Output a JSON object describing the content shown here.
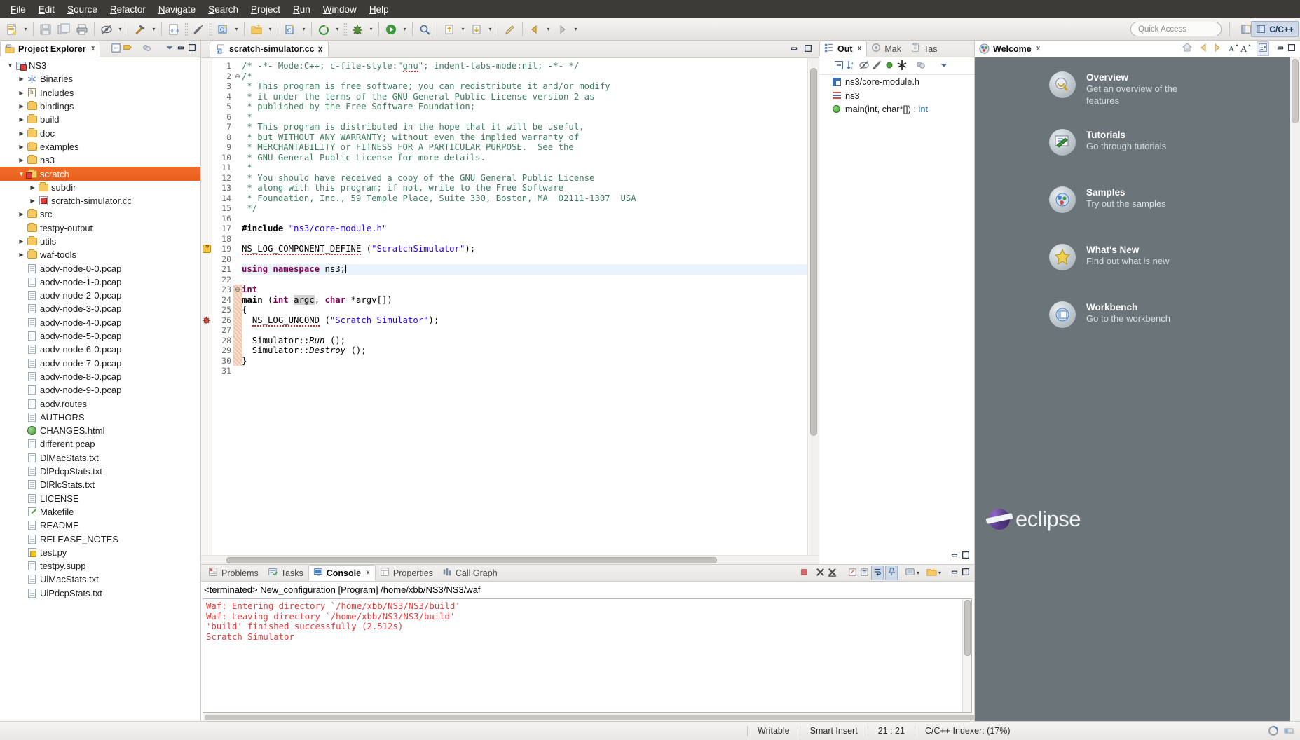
{
  "menu": {
    "items": [
      "File",
      "Edit",
      "Source",
      "Refactor",
      "Navigate",
      "Search",
      "Project",
      "Run",
      "Window",
      "Help"
    ]
  },
  "toolbar": {
    "quick_access_placeholder": "Quick Access",
    "perspective_label": "C/C++",
    "buttons": [
      "new-wizard",
      "save",
      "save-all",
      "print",
      "toggle-mark-occurrences",
      "build-hammer",
      "build-config",
      "skip-breakpoints",
      "new-c-class",
      "new-c-project",
      "new-c-source-file",
      "run-external-tools",
      "debug",
      "run"
    ]
  },
  "project_explorer": {
    "title": "Project Explorer",
    "toolbar": [
      "collapse-all",
      "link-with-editor",
      "focus-on-active-task",
      "view-menu",
      "minimize",
      "maximize"
    ],
    "tree": [
      {
        "label": "NS3",
        "depth": 0,
        "arrow": "down",
        "icon": "project",
        "selected": false
      },
      {
        "label": "Binaries",
        "depth": 1,
        "arrow": "right",
        "icon": "binaries",
        "selected": false
      },
      {
        "label": "Includes",
        "depth": 1,
        "arrow": "right",
        "icon": "includes",
        "selected": false
      },
      {
        "label": "bindings",
        "depth": 1,
        "arrow": "right",
        "icon": "folder",
        "selected": false
      },
      {
        "label": "build",
        "depth": 1,
        "arrow": "right",
        "icon": "folder",
        "selected": false
      },
      {
        "label": "doc",
        "depth": 1,
        "arrow": "right",
        "icon": "folder",
        "selected": false
      },
      {
        "label": "examples",
        "depth": 1,
        "arrow": "right",
        "icon": "folder",
        "selected": false
      },
      {
        "label": "ns3",
        "depth": 1,
        "arrow": "right",
        "icon": "folder",
        "selected": false
      },
      {
        "label": "scratch",
        "depth": 1,
        "arrow": "down",
        "icon": "source-folder",
        "selected": true
      },
      {
        "label": "subdir",
        "depth": 2,
        "arrow": "right",
        "icon": "folder",
        "selected": false
      },
      {
        "label": "scratch-simulator.cc",
        "depth": 2,
        "arrow": "right",
        "icon": "cc-file",
        "selected": false
      },
      {
        "label": "src",
        "depth": 1,
        "arrow": "right",
        "icon": "folder",
        "selected": false
      },
      {
        "label": "testpy-output",
        "depth": 1,
        "arrow": "none",
        "icon": "folder",
        "selected": false
      },
      {
        "label": "utils",
        "depth": 1,
        "arrow": "right",
        "icon": "folder",
        "selected": false
      },
      {
        "label": "waf-tools",
        "depth": 1,
        "arrow": "right",
        "icon": "folder",
        "selected": false
      },
      {
        "label": "aodv-node-0-0.pcap",
        "depth": 1,
        "arrow": "none",
        "icon": "file",
        "selected": false
      },
      {
        "label": "aodv-node-1-0.pcap",
        "depth": 1,
        "arrow": "none",
        "icon": "file",
        "selected": false
      },
      {
        "label": "aodv-node-2-0.pcap",
        "depth": 1,
        "arrow": "none",
        "icon": "file",
        "selected": false
      },
      {
        "label": "aodv-node-3-0.pcap",
        "depth": 1,
        "arrow": "none",
        "icon": "file",
        "selected": false
      },
      {
        "label": "aodv-node-4-0.pcap",
        "depth": 1,
        "arrow": "none",
        "icon": "file",
        "selected": false
      },
      {
        "label": "aodv-node-5-0.pcap",
        "depth": 1,
        "arrow": "none",
        "icon": "file",
        "selected": false
      },
      {
        "label": "aodv-node-6-0.pcap",
        "depth": 1,
        "arrow": "none",
        "icon": "file",
        "selected": false
      },
      {
        "label": "aodv-node-7-0.pcap",
        "depth": 1,
        "arrow": "none",
        "icon": "file",
        "selected": false
      },
      {
        "label": "aodv-node-8-0.pcap",
        "depth": 1,
        "arrow": "none",
        "icon": "file",
        "selected": false
      },
      {
        "label": "aodv-node-9-0.pcap",
        "depth": 1,
        "arrow": "none",
        "icon": "file",
        "selected": false
      },
      {
        "label": "aodv.routes",
        "depth": 1,
        "arrow": "none",
        "icon": "file",
        "selected": false
      },
      {
        "label": "AUTHORS",
        "depth": 1,
        "arrow": "none",
        "icon": "file",
        "selected": false
      },
      {
        "label": "CHANGES.html",
        "depth": 1,
        "arrow": "none",
        "icon": "html",
        "selected": false
      },
      {
        "label": "different.pcap",
        "depth": 1,
        "arrow": "none",
        "icon": "file",
        "selected": false
      },
      {
        "label": "DlMacStats.txt",
        "depth": 1,
        "arrow": "none",
        "icon": "file",
        "selected": false
      },
      {
        "label": "DlPdcpStats.txt",
        "depth": 1,
        "arrow": "none",
        "icon": "file",
        "selected": false
      },
      {
        "label": "DlRlcStats.txt",
        "depth": 1,
        "arrow": "none",
        "icon": "file",
        "selected": false
      },
      {
        "label": "LICENSE",
        "depth": 1,
        "arrow": "none",
        "icon": "file",
        "selected": false
      },
      {
        "label": "Makefile",
        "depth": 1,
        "arrow": "none",
        "icon": "makefile",
        "selected": false
      },
      {
        "label": "README",
        "depth": 1,
        "arrow": "none",
        "icon": "file",
        "selected": false
      },
      {
        "label": "RELEASE_NOTES",
        "depth": 1,
        "arrow": "none",
        "icon": "file",
        "selected": false
      },
      {
        "label": "test.py",
        "depth": 1,
        "arrow": "none",
        "icon": "python",
        "selected": false
      },
      {
        "label": "testpy.supp",
        "depth": 1,
        "arrow": "none",
        "icon": "file",
        "selected": false
      },
      {
        "label": "UlMacStats.txt",
        "depth": 1,
        "arrow": "none",
        "icon": "file",
        "selected": false
      },
      {
        "label": "UlPdcpStats.txt",
        "depth": 1,
        "arrow": "none",
        "icon": "file",
        "selected": false
      }
    ]
  },
  "editor": {
    "tab_label": "scratch-simulator.cc",
    "tab_close": "⌧",
    "lines": [
      {
        "n": 1,
        "html": "<span class=\"cmt\">/* -*- Mode:C++; c-file-style:\"<span class=\"spellerr\">gnu</span>\"; indent-tabs-mode:nil; -*- */</span>"
      },
      {
        "n": 2,
        "html": "<span class=\"cmt\">/*</span>",
        "fold": true
      },
      {
        "n": 3,
        "html": "<span class=\"cmt\"> * This program is free software; you can redistribute it and/or modify</span>"
      },
      {
        "n": 4,
        "html": "<span class=\"cmt\"> * it under the terms of the GNU General Public License version 2 as</span>"
      },
      {
        "n": 5,
        "html": "<span class=\"cmt\"> * published by the Free Software Foundation;</span>"
      },
      {
        "n": 6,
        "html": "<span class=\"cmt\"> *</span>"
      },
      {
        "n": 7,
        "html": "<span class=\"cmt\"> * This program is distributed in the hope that it will be useful,</span>"
      },
      {
        "n": 8,
        "html": "<span class=\"cmt\"> * but WITHOUT ANY WARRANTY; without even the implied warranty of</span>"
      },
      {
        "n": 9,
        "html": "<span class=\"cmt\"> * MERCHANTABILITY or FITNESS FOR A PARTICULAR PURPOSE.  See the</span>"
      },
      {
        "n": 10,
        "html": "<span class=\"cmt\"> * GNU General Public License for more details.</span>"
      },
      {
        "n": 11,
        "html": "<span class=\"cmt\"> *</span>"
      },
      {
        "n": 12,
        "html": "<span class=\"cmt\"> * You should have received a copy of the GNU General Public License</span>"
      },
      {
        "n": 13,
        "html": "<span class=\"cmt\"> * along with this program; if not, write to the Free Software</span>"
      },
      {
        "n": 14,
        "html": "<span class=\"cmt\"> * Foundation, Inc., 59 Temple Place, Suite 330, Boston, MA  02111-1307  USA</span>"
      },
      {
        "n": 15,
        "html": "<span class=\"cmt\"> */</span>"
      },
      {
        "n": 16,
        "html": ""
      },
      {
        "n": 17,
        "html": "<span class=\"pre\">#include</span> <span class=\"str\">\"ns3/core-module.h\"</span>"
      },
      {
        "n": 18,
        "html": ""
      },
      {
        "n": 19,
        "html": "<span class=\"spellerr\">NS_LOG_COMPONENT_DEFINE</span> (<span class=\"str\">\"ScratchSimulator\"</span>);",
        "marker": "warning"
      },
      {
        "n": 20,
        "html": ""
      },
      {
        "n": 21,
        "html": "<span class=\"kw\">using namespace</span> ns3;<span class=\"caret\"></span>",
        "highlight": true
      },
      {
        "n": 22,
        "html": ""
      },
      {
        "n": 23,
        "html": "<span class=\"kw\">int</span>",
        "fold": true,
        "changed": true
      },
      {
        "n": 24,
        "html": "<span class=\"pre\">main</span> (<span class=\"kw\">int</span> <span class=\"occ\">argc</span>, <span class=\"kw\">char</span> *argv[])",
        "changed": true
      },
      {
        "n": 25,
        "html": "{",
        "changed": true
      },
      {
        "n": 26,
        "html": "  <span class=\"spellerr\">NS_LOG_UNCOND</span> (<span class=\"str\">\"Scratch Simulator\"</span>);",
        "marker": "bug",
        "changed": true
      },
      {
        "n": 27,
        "html": "",
        "changed": true
      },
      {
        "n": 28,
        "html": "  Simulator::<span class=\"ital\">Run</span> ();",
        "changed": true
      },
      {
        "n": 29,
        "html": "  Simulator::<span class=\"ital\">Destroy</span> ();",
        "changed": true
      },
      {
        "n": 30,
        "html": "}",
        "changed": true
      },
      {
        "n": 31,
        "html": ""
      }
    ]
  },
  "outline": {
    "tabs": [
      {
        "label": "Out",
        "active": true,
        "closeable": true
      },
      {
        "label": "Mak",
        "active": false,
        "closeable": false
      },
      {
        "label": "Tas",
        "active": false,
        "closeable": false
      }
    ],
    "toolbar": [
      "collapse-all",
      "sort",
      "hide-fields",
      "hide-static",
      "hide-non-public",
      "hide-macros",
      "focus-active-task",
      "view-menu"
    ],
    "items": [
      {
        "label": "ns3/core-module.h",
        "icon": "include"
      },
      {
        "label": "ns3",
        "icon": "namespace"
      },
      {
        "label": "main(int, char*[]) : int",
        "icon": "function"
      }
    ]
  },
  "welcome": {
    "title": "Welcome",
    "toolbar": [
      "home",
      "back",
      "forward",
      "decrease-font",
      "increase-font",
      "customize-page",
      "minimize",
      "maximize"
    ],
    "items": [
      {
        "title": "Overview",
        "desc": "Get an overview of the features",
        "icon": "overview-icon"
      },
      {
        "title": "Tutorials",
        "desc": "Go through tutorials",
        "icon": "tutorials-icon"
      },
      {
        "title": "Samples",
        "desc": "Try out the samples",
        "icon": "samples-icon"
      },
      {
        "title": "What's New",
        "desc": "Find out what is new",
        "icon": "whats-new-icon"
      },
      {
        "title": "Workbench",
        "desc": "Go to the workbench",
        "icon": "workbench-icon"
      }
    ],
    "brand": "eclipse"
  },
  "console": {
    "tabs": [
      {
        "label": "Problems",
        "active": false,
        "icon": "problems-icon"
      },
      {
        "label": "Tasks",
        "active": false,
        "icon": "tasks-icon"
      },
      {
        "label": "Console",
        "active": true,
        "icon": "console-icon"
      },
      {
        "label": "Properties",
        "active": false,
        "icon": "properties-icon"
      },
      {
        "label": "Call Graph",
        "active": false,
        "icon": "call-graph-icon"
      }
    ],
    "header": "<terminated> New_configuration [Program] /home/xbb/NS3/NS3/waf",
    "lines": [
      {
        "text": "Waf: Entering directory `/home/xbb/NS3/NS3/build'",
        "error": true
      },
      {
        "text": "Waf: Leaving directory `/home/xbb/NS3/NS3/build'",
        "error": true
      },
      {
        "text": "'build' finished successfully (2.512s)",
        "error": true
      },
      {
        "text": "Scratch Simulator",
        "error": true
      }
    ],
    "toolbar": [
      "terminate",
      "remove-launch",
      "remove-all-terminated",
      "clear-console",
      "scroll-lock",
      "word-wrap",
      "pin-console",
      "display-selected-console",
      "open-console",
      "minimize",
      "maximize"
    ]
  },
  "statusbar": {
    "writable": "Writable",
    "insert_mode": "Smart Insert",
    "position": "21 : 21",
    "indexer": "C/C++ Indexer: (17%)"
  }
}
